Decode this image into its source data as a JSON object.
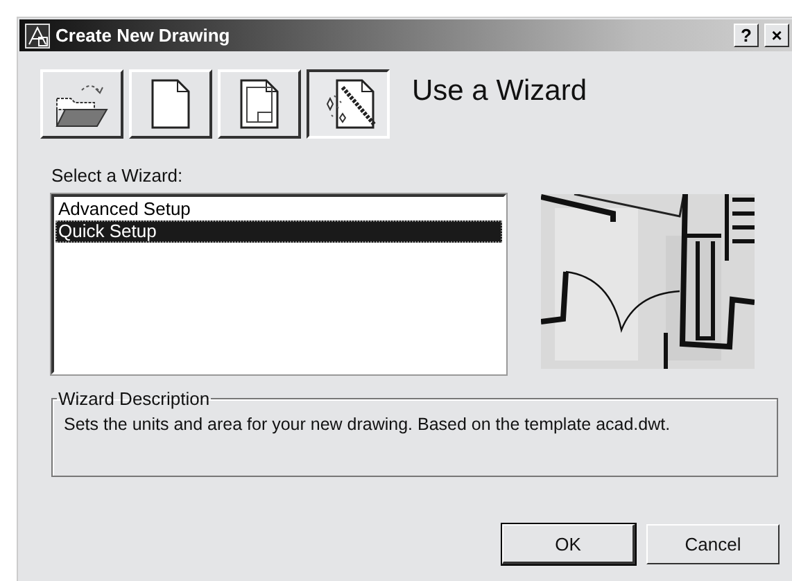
{
  "window": {
    "title": "Create New Drawing",
    "help_button": "?",
    "close_button": "×"
  },
  "toolbar": [
    {
      "kind": "open",
      "selected": false
    },
    {
      "kind": "blank",
      "selected": false
    },
    {
      "kind": "template",
      "selected": false
    },
    {
      "kind": "wizard",
      "selected": true
    }
  ],
  "heading": "Use a Wizard",
  "list_label": "Select a Wizard:",
  "wizards": [
    {
      "label": "Advanced Setup",
      "selected": false
    },
    {
      "label": "Quick Setup",
      "selected": true
    }
  ],
  "description_group": {
    "title": "Wizard Description",
    "text": "Sets the units and area for your new drawing. Based on the template acad.dwt."
  },
  "buttons": [
    {
      "label": "OK",
      "default": true
    },
    {
      "label": "Cancel",
      "default": false
    }
  ]
}
